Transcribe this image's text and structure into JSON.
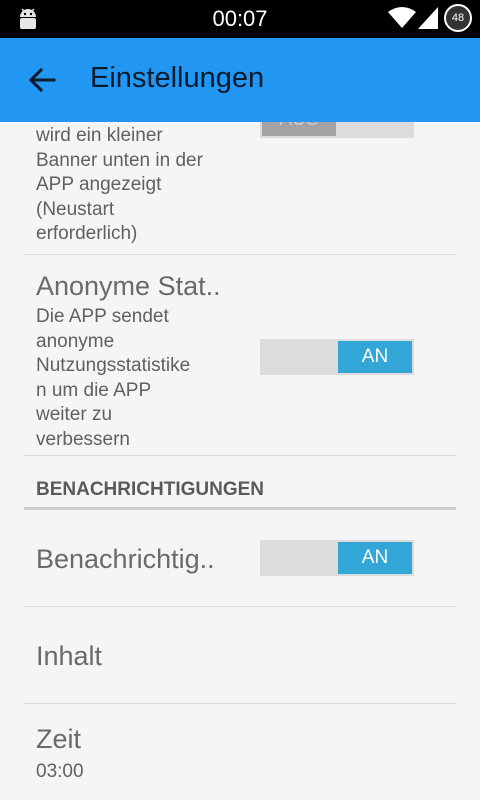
{
  "status_bar": {
    "time": "00:07",
    "battery_level": "48",
    "icons": [
      "android-icon",
      "wifi-icon",
      "signal-icon",
      "battery-icon"
    ]
  },
  "app_bar": {
    "title": "Einstellungen",
    "back_icon": "arrow-back-icon",
    "color": "#2196f3"
  },
  "preferences": {
    "banner": {
      "summary_lines": [
        "wird ein kleiner",
        "Banner unten in der",
        "APP angezeigt",
        "(Neustart",
        "erforderlich)"
      ],
      "toggle_label": "AUS",
      "checked": false
    },
    "anonymous_stats": {
      "title": "Anonyme Stat..",
      "summary_lines": [
        "Die APP sendet",
        "anonyme",
        "Nutzungsstatistike",
        "n um die APP",
        "weiter zu",
        "verbessern"
      ],
      "toggle_label": "AN",
      "checked": true
    },
    "category_notifications": "BENACHRICHTIGUNGEN",
    "notifications": {
      "title": "Benachrichtig..",
      "toggle_label": "AN",
      "checked": true
    },
    "content": {
      "title": "Inhalt"
    },
    "time": {
      "title": "Zeit",
      "summary": "03:00"
    }
  },
  "colors": {
    "accent": "#33a6d8",
    "toggle_track": "#dcdcdc",
    "toggle_off_thumb": "#a3a3a3"
  }
}
